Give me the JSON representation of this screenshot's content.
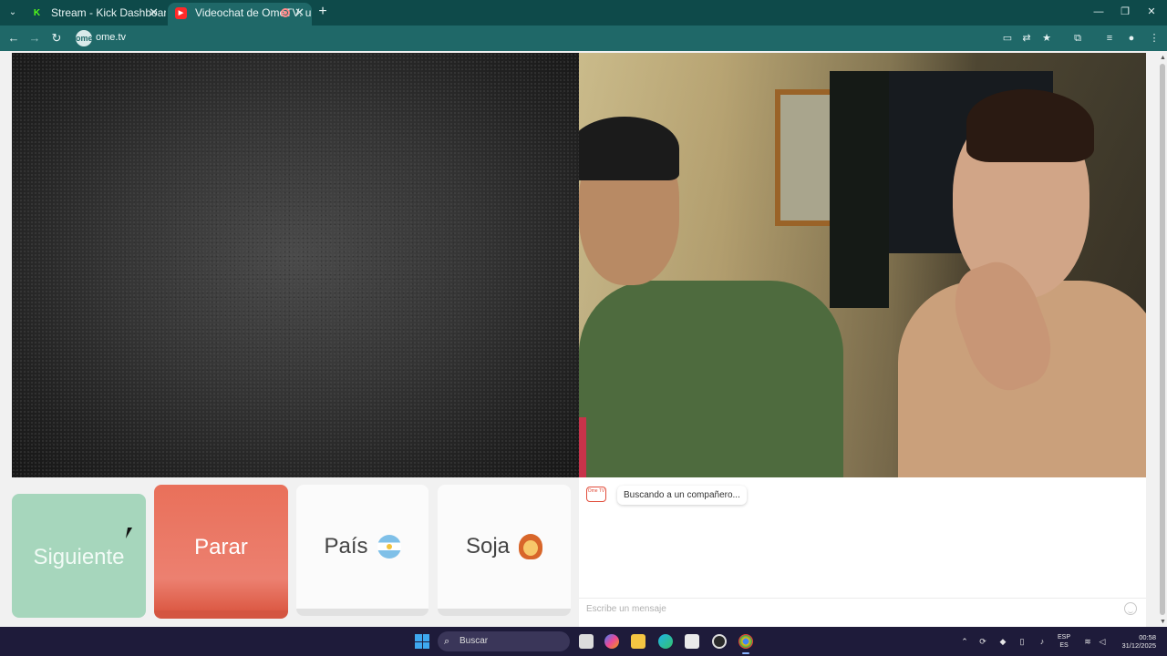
{
  "browser": {
    "tabs": [
      {
        "label": "Stream - Kick Dashboard",
        "icon": "kick-icon"
      },
      {
        "label": "Videochat de OmeTV: una",
        "icon": "ometv-icon",
        "active": true
      }
    ],
    "url": "ome.tv",
    "site_icon_text": "ome"
  },
  "controls": {
    "next_label": "Siguiente",
    "stop_label": "Parar",
    "country_label": "País",
    "gender_label": "Soja"
  },
  "chat": {
    "logo_text": "Ome TV",
    "status_message": "Buscando a un compañero...",
    "input_placeholder": "Escribe un mensaje"
  },
  "taskbar": {
    "search_label": "Buscar",
    "lang_top": "ESP",
    "lang_bottom": "ES",
    "time": "00:58",
    "date": "31/12/2025"
  },
  "colors": {
    "chrome_dark": "#0e4a4a",
    "chrome": "#1f6868",
    "next_button": "#a6d6bc",
    "stop_button": "#e9705a",
    "taskbar": "#1e1b3a"
  }
}
